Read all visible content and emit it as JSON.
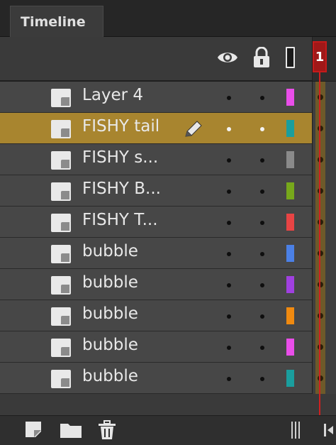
{
  "panel": {
    "tab_label": "Timeline"
  },
  "header": {
    "icons": {
      "eye": "eye-icon",
      "lock": "lock-icon",
      "outline": "outline-icon"
    },
    "current_frame": "1"
  },
  "layers": [
    {
      "name": "Layer 4",
      "color": "#e94ee9",
      "selected": false
    },
    {
      "name": "FISHY tail",
      "color": "#1a9e9e",
      "selected": true
    },
    {
      "name": "FISHY s...",
      "color": "#8a8a8a",
      "selected": false
    },
    {
      "name": "FISHY B...",
      "color": "#77a81b",
      "selected": false
    },
    {
      "name": "FISHY T...",
      "color": "#e84444",
      "selected": false
    },
    {
      "name": "bubble",
      "color": "#4b80e6",
      "selected": false
    },
    {
      "name": "bubble",
      "color": "#a040e0",
      "selected": false
    },
    {
      "name": "bubble",
      "color": "#f08a10",
      "selected": false
    },
    {
      "name": "bubble",
      "color": "#e94ee9",
      "selected": false
    },
    {
      "name": "bubble",
      "color": "#1a9e9e",
      "selected": false
    }
  ],
  "toolbar": {
    "icons": [
      "new-layer-icon",
      "new-folder-icon",
      "delete-icon",
      "splitter-icon",
      "go-to-first-frame-icon"
    ]
  },
  "colors": {
    "selected_row": "#a8852f",
    "playhead": "#cf2020",
    "panel_bg": "#474747"
  }
}
